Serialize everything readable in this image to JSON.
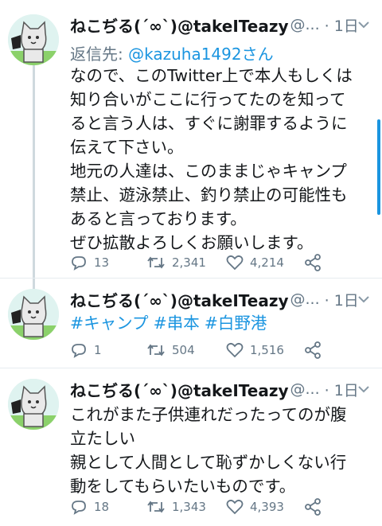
{
  "tweets": [
    {
      "name": "ねこぢる(´∞`)@takeITeazy",
      "handle": "@...",
      "time": "· 1日",
      "reply_label": "返信先: ",
      "reply_to": "@kazuha1492さん",
      "text": "なので、このTwitter上で本人もしくは\n知り合いがここに行ってたのを知って\nると言う人は、すぐに謝罪するように\n伝えて下さい。\n地元の人達は、このままじゃキャンプ\n禁止、遊泳禁止、釣り禁止の可能性も\nあると言っております。\nぜひ拡散よろしくお願いします。",
      "replies": "13",
      "retweets": "2,341",
      "likes": "4,214"
    },
    {
      "name": "ねこぢる(´∞`)@takeITeazy",
      "handle": "@...",
      "time": "· 1日",
      "hashtags": [
        "#キャンプ",
        "#串本",
        "#白野港"
      ],
      "replies": "1",
      "retweets": "504",
      "likes": "1,516"
    },
    {
      "name": "ねこぢる(´∞`)@takeITeazy",
      "handle": "@...",
      "time": "· 1日",
      "text": "これがまた子供連れだったってのが腹\n立たしい\n親として人間として恥ずかしくない行\n動をしてもらいたいものです。",
      "replies": "18",
      "retweets": "1,343",
      "likes": "4,393"
    }
  ],
  "icons": [
    "chevron-down-icon",
    "reply-icon",
    "retweet-icon",
    "like-icon",
    "share-icon"
  ],
  "colors": {
    "link": "#1b95e0",
    "secondary": "#657786",
    "text": "#14171a",
    "thread": "#cfd9de"
  }
}
